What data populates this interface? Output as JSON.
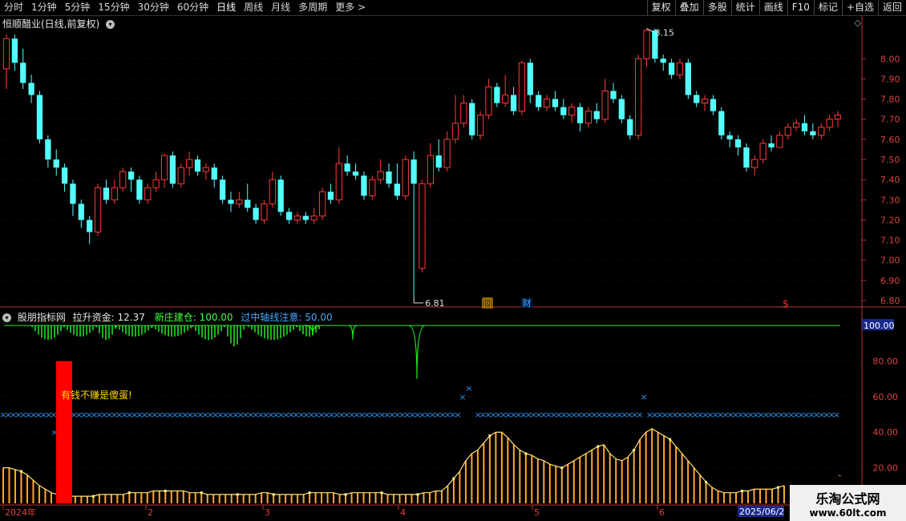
{
  "toolbar": {
    "left_items": [
      "分时",
      "1分钟",
      "5分钟",
      "15分钟",
      "30分钟",
      "60分钟",
      "日线",
      "周线",
      "月线",
      "多周期",
      "更多 >"
    ],
    "active_index": 6,
    "right_items": [
      "复权",
      "叠加",
      "多股",
      "统计",
      "画线",
      "F10",
      "标记",
      "+自选",
      "返回"
    ]
  },
  "stock_title": "恒顺醋业(日线,前复权)",
  "indicator": {
    "name": "股朋指标网",
    "label1": "拉升资金: 12.37",
    "label2": "新庄建仓: 100.00",
    "label3": "过中轴线注意: 50.00",
    "annotation": "有钱不赚是傻蛋!"
  },
  "price_axis": {
    "ticks": [
      "8.00",
      "7.90",
      "7.80",
      "7.70",
      "7.60",
      "7.50",
      "7.40",
      "7.30",
      "7.20",
      "7.10",
      "7.00",
      "6.90",
      "6.80"
    ],
    "high_label": "8.15",
    "low_label": "6.81"
  },
  "ind_axis": {
    "ticks": [
      "80.00",
      "60.00",
      "40.00",
      "20.00"
    ],
    "highlight": "100.00"
  },
  "date_axis": {
    "labels": [
      "2024年",
      "2",
      "3",
      "4",
      "5",
      "6"
    ],
    "current": "2025/06/2"
  },
  "markers": {
    "hui": "回",
    "cai": "财",
    "dollar": "$"
  },
  "watermark": {
    "line1": "乐淘公式网",
    "line2": "www.60lt.com"
  },
  "colors": {
    "up": "#ff3b3b",
    "down": "#54ffff",
    "green": "#22ee22",
    "orange": "#ffa830",
    "blue_x": "#2a8fe8",
    "red_bar": "#ff0000",
    "axis": "#c03030"
  },
  "chart_data": [
    {
      "type": "candlestick",
      "ylim": [
        6.78,
        8.18
      ],
      "bars": [
        [
          7.95,
          8.1,
          8.12,
          7.85
        ],
        [
          8.1,
          7.98,
          8.12,
          7.94
        ],
        [
          7.98,
          7.88,
          8.05,
          7.85
        ],
        [
          7.88,
          7.82,
          7.92,
          7.78
        ],
        [
          7.82,
          7.6,
          7.84,
          7.58
        ],
        [
          7.6,
          7.5,
          7.62,
          7.46
        ],
        [
          7.5,
          7.46,
          7.55,
          7.42
        ],
        [
          7.46,
          7.38,
          7.48,
          7.34
        ],
        [
          7.38,
          7.28,
          7.4,
          7.22
        ],
        [
          7.28,
          7.2,
          7.3,
          7.16
        ],
        [
          7.2,
          7.14,
          7.22,
          7.08
        ],
        [
          7.14,
          7.36,
          7.38,
          7.12
        ],
        [
          7.36,
          7.3,
          7.4,
          7.28
        ],
        [
          7.3,
          7.36,
          7.4,
          7.28
        ],
        [
          7.36,
          7.44,
          7.46,
          7.34
        ],
        [
          7.44,
          7.4,
          7.46,
          7.34
        ],
        [
          7.4,
          7.3,
          7.42,
          7.28
        ],
        [
          7.3,
          7.36,
          7.38,
          7.28
        ],
        [
          7.36,
          7.4,
          7.44,
          7.34
        ],
        [
          7.4,
          7.52,
          7.53,
          7.36
        ],
        [
          7.52,
          7.38,
          7.54,
          7.36
        ],
        [
          7.38,
          7.46,
          7.48,
          7.36
        ],
        [
          7.46,
          7.5,
          7.54,
          7.42
        ],
        [
          7.5,
          7.44,
          7.52,
          7.42
        ],
        [
          7.44,
          7.46,
          7.48,
          7.4
        ],
        [
          7.46,
          7.4,
          7.48,
          7.36
        ],
        [
          7.4,
          7.3,
          7.42,
          7.28
        ],
        [
          7.3,
          7.28,
          7.34,
          7.24
        ],
        [
          7.28,
          7.3,
          7.34,
          7.26
        ],
        [
          7.3,
          7.26,
          7.38,
          7.24
        ],
        [
          7.26,
          7.2,
          7.28,
          7.18
        ],
        [
          7.2,
          7.28,
          7.3,
          7.18
        ],
        [
          7.28,
          7.4,
          7.44,
          7.26
        ],
        [
          7.4,
          7.24,
          7.42,
          7.22
        ],
        [
          7.24,
          7.2,
          7.26,
          7.18
        ],
        [
          7.2,
          7.22,
          7.24,
          7.18
        ],
        [
          7.22,
          7.2,
          7.24,
          7.18
        ],
        [
          7.2,
          7.22,
          7.26,
          7.18
        ],
        [
          7.22,
          7.34,
          7.36,
          7.2
        ],
        [
          7.34,
          7.3,
          7.38,
          7.28
        ],
        [
          7.3,
          7.48,
          7.56,
          7.28
        ],
        [
          7.48,
          7.44,
          7.52,
          7.42
        ],
        [
          7.44,
          7.42,
          7.48,
          7.4
        ],
        [
          7.42,
          7.32,
          7.44,
          7.3
        ],
        [
          7.32,
          7.4,
          7.42,
          7.3
        ],
        [
          7.4,
          7.44,
          7.5,
          7.38
        ],
        [
          7.44,
          7.38,
          7.48,
          7.36
        ],
        [
          7.38,
          7.32,
          7.48,
          7.3
        ],
        [
          7.32,
          7.5,
          7.52,
          7.3
        ],
        [
          7.5,
          7.38,
          7.54,
          6.82
        ],
        [
          6.96,
          7.38,
          7.4,
          6.94
        ],
        [
          7.38,
          7.52,
          7.58,
          7.36
        ],
        [
          7.52,
          7.46,
          7.6,
          7.44
        ],
        [
          7.46,
          7.6,
          7.64,
          7.44
        ],
        [
          7.6,
          7.68,
          7.82,
          7.58
        ],
        [
          7.68,
          7.78,
          7.82,
          7.66
        ],
        [
          7.78,
          7.62,
          7.8,
          7.6
        ],
        [
          7.62,
          7.72,
          7.74,
          7.6
        ],
        [
          7.72,
          7.86,
          7.9,
          7.7
        ],
        [
          7.86,
          7.78,
          7.88,
          7.76
        ],
        [
          7.78,
          7.82,
          7.92,
          7.76
        ],
        [
          7.82,
          7.74,
          7.86,
          7.72
        ],
        [
          7.74,
          7.98,
          7.99,
          7.72
        ],
        [
          7.98,
          7.82,
          8.0,
          7.78
        ],
        [
          7.82,
          7.76,
          7.84,
          7.74
        ],
        [
          7.76,
          7.8,
          7.82,
          7.74
        ],
        [
          7.8,
          7.76,
          7.84,
          7.74
        ],
        [
          7.76,
          7.72,
          7.8,
          7.7
        ],
        [
          7.72,
          7.76,
          7.78,
          7.68
        ],
        [
          7.76,
          7.68,
          7.78,
          7.64
        ],
        [
          7.68,
          7.74,
          7.76,
          7.66
        ],
        [
          7.74,
          7.7,
          7.78,
          7.68
        ],
        [
          7.7,
          7.84,
          7.9,
          7.68
        ],
        [
          7.84,
          7.8,
          7.88,
          7.78
        ],
        [
          7.8,
          7.7,
          7.82,
          7.68
        ],
        [
          7.7,
          7.62,
          7.72,
          7.6
        ],
        [
          7.62,
          8.0,
          8.02,
          7.6
        ],
        [
          8.0,
          8.14,
          8.15,
          7.96
        ],
        [
          8.14,
          8.0,
          8.15,
          7.98
        ],
        [
          8.0,
          7.98,
          8.02,
          7.94
        ],
        [
          7.98,
          7.92,
          8.0,
          7.9
        ],
        [
          7.92,
          7.98,
          8.0,
          7.9
        ],
        [
          7.98,
          7.82,
          8.0,
          7.8
        ],
        [
          7.82,
          7.78,
          7.84,
          7.76
        ],
        [
          7.78,
          7.8,
          7.82,
          7.74
        ],
        [
          7.8,
          7.74,
          7.82,
          7.72
        ],
        [
          7.74,
          7.62,
          7.76,
          7.6
        ],
        [
          7.62,
          7.6,
          7.64,
          7.56
        ],
        [
          7.6,
          7.56,
          7.62,
          7.52
        ],
        [
          7.56,
          7.46,
          7.58,
          7.44
        ],
        [
          7.46,
          7.5,
          7.52,
          7.42
        ],
        [
          7.5,
          7.58,
          7.6,
          7.48
        ],
        [
          7.58,
          7.56,
          7.62,
          7.54
        ],
        [
          7.56,
          7.62,
          7.64,
          7.56
        ],
        [
          7.62,
          7.66,
          7.68,
          7.6
        ],
        [
          7.66,
          7.68,
          7.7,
          7.64
        ],
        [
          7.68,
          7.64,
          7.72,
          7.62
        ],
        [
          7.64,
          7.62,
          7.68,
          7.6
        ],
        [
          7.62,
          7.66,
          7.68,
          7.6
        ],
        [
          7.66,
          7.7,
          7.72,
          7.64
        ],
        [
          7.7,
          7.72,
          7.74,
          7.66
        ]
      ]
    },
    {
      "type": "indicator",
      "ylim": [
        0,
        105
      ],
      "ticks": [
        80,
        60,
        40,
        20
      ],
      "green_top": 100,
      "green_dips": [
        [
          40,
          80,
          92
        ],
        [
          80,
          120,
          94
        ],
        [
          120,
          145,
          92
        ],
        [
          145,
          190,
          94
        ],
        [
          190,
          240,
          94
        ],
        [
          240,
          280,
          92
        ],
        [
          280,
          305,
          88
        ],
        [
          310,
          370,
          92
        ],
        [
          370,
          400,
          94
        ],
        [
          380,
          400,
          95
        ],
        [
          435,
          445,
          92
        ],
        [
          510,
          530,
          70
        ]
      ],
      "blue_line": 50,
      "blue_x_gaps": [
        [
          68,
          90
        ],
        [
          572,
          590
        ],
        [
          800,
          810
        ]
      ],
      "blue_x_extra": [
        [
          68,
          40
        ],
        [
          577,
          60
        ],
        [
          585,
          65
        ],
        [
          803,
          60
        ]
      ],
      "red_bar": [
        70,
        0,
        80
      ],
      "orange": [
        20,
        20,
        19,
        18,
        16,
        13,
        10,
        8,
        6,
        5,
        4,
        4,
        4,
        4,
        4,
        4,
        5,
        5,
        5,
        5,
        5,
        6,
        6,
        6,
        6,
        7,
        7,
        7,
        7,
        7,
        7,
        6,
        6,
        6,
        5,
        5,
        5,
        5,
        5,
        5,
        5,
        5,
        5,
        6,
        6,
        5,
        5,
        5,
        5,
        5,
        5,
        6,
        6,
        6,
        6,
        6,
        5,
        5,
        6,
        6,
        6,
        6,
        6,
        6,
        5,
        5,
        5,
        5,
        5,
        5,
        6,
        6,
        7,
        7,
        10,
        14,
        18,
        24,
        28,
        30,
        34,
        38,
        40,
        40,
        37,
        33,
        30,
        28,
        27,
        25,
        24,
        22,
        21,
        20,
        22,
        24,
        26,
        28,
        30,
        32,
        33,
        28,
        25,
        24,
        26,
        30,
        36,
        40,
        42,
        40,
        38,
        36,
        32,
        28,
        24,
        20,
        16,
        12,
        9,
        7,
        6,
        6,
        6,
        7,
        7,
        8,
        8,
        8,
        8,
        9,
        10
      ]
    }
  ]
}
